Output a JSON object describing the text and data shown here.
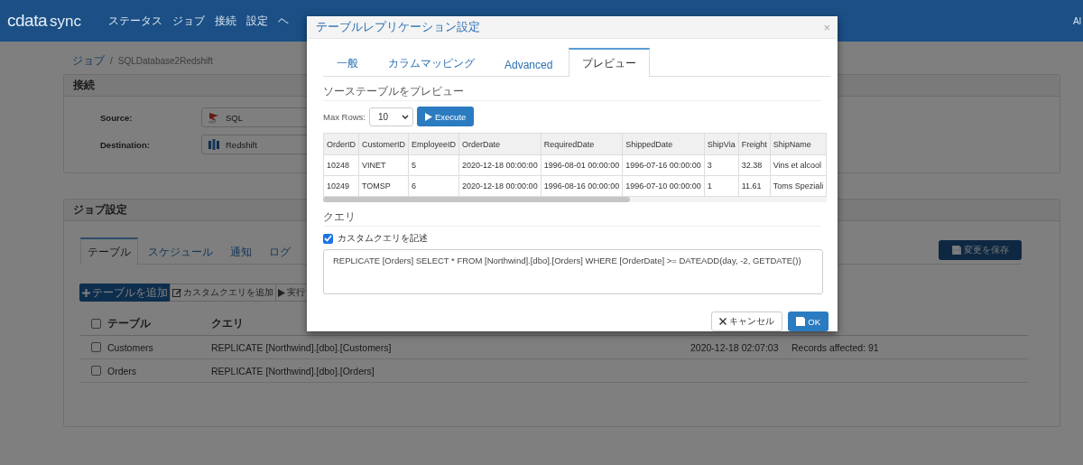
{
  "nav": {
    "logo": "cdata",
    "logo_sub": "sync",
    "items": [
      "ステータス",
      "ジョブ",
      "接続",
      "設定",
      "ヘ"
    ],
    "user": "Al"
  },
  "breadcrumb": [
    "ジョブ",
    "SQLDatabase2Redshift"
  ],
  "breadcrumb_separator": "/",
  "connection": {
    "title": "接続",
    "rows": [
      {
        "label": "Source:",
        "value": "SQL",
        "kind": "sql"
      },
      {
        "label": "Destination:",
        "value": "Redshift",
        "kind": "redshift"
      }
    ]
  },
  "job_settings": {
    "title": "ジョブ設定",
    "tabs": [
      {
        "label": "テーブル",
        "selected": true
      },
      {
        "label": "スケジュール",
        "selected": false
      },
      {
        "label": "通知",
        "selected": false
      },
      {
        "label": "ログ",
        "selected": false
      }
    ],
    "save_button": "変更を保存",
    "actions": [
      {
        "label": "テーブルを追加",
        "kind": "add"
      },
      {
        "label": "カスタムクエリを追加",
        "kind": "edit"
      },
      {
        "label": "実行",
        "kind": "run"
      }
    ],
    "table": {
      "header_checked": false,
      "columns": [
        "テーブル",
        "クエリ"
      ],
      "rows": [
        {
          "checked": false,
          "table": "Customers",
          "query": "REPLICATE [Northwind].[dbo].[Customers]",
          "time": "2020-12-18 02:07:03",
          "result": "Records affected: 91"
        },
        {
          "checked": false,
          "table": "Orders",
          "query": "REPLICATE [Northwind].[dbo].[Orders]"
        }
      ]
    }
  },
  "modal": {
    "title": "テーブルレプリケーション設定",
    "close": "×",
    "tabs": [
      {
        "label": "一般",
        "selected": false
      },
      {
        "label": "カラムマッピング",
        "selected": false
      },
      {
        "label": "Advanced",
        "selected": false
      },
      {
        "label": "プレビュー",
        "selected": true
      }
    ],
    "preview_heading": "ソーステーブルをプレビュー",
    "max_rows_label": "Max Rows:",
    "max_rows_value": "10",
    "execute_button": "Execute",
    "grid": {
      "columns": [
        "OrderID",
        "CustomerID",
        "EmployeeID",
        "OrderDate",
        "RequiredDate",
        "ShippedDate",
        "ShipVia",
        "Freight",
        "ShipName"
      ],
      "rows": [
        [
          "10248",
          "VINET",
          "5",
          "2020-12-18 00:00:00",
          "1996-08-01 00:00:00",
          "1996-07-16 00:00:00",
          "3",
          "32.38",
          "Vins et alcool"
        ],
        [
          "10249",
          "TOMSP",
          "6",
          "2020-12-18 00:00:00",
          "1996-08-16 00:00:00",
          "1996-07-10 00:00:00",
          "1",
          "11.61",
          "Toms Speziali"
        ]
      ]
    },
    "query_heading": "クエリ",
    "custom_query": {
      "label": "カスタムクエリを記述",
      "checked": true
    },
    "query": "REPLICATE [Orders] SELECT * FROM [Northwind].[dbo].[Orders] WHERE [OrderDate] >= DATEADD(day, -2, GETDATE())",
    "cancel_button": "キャンセル",
    "ok_button": "OK"
  }
}
